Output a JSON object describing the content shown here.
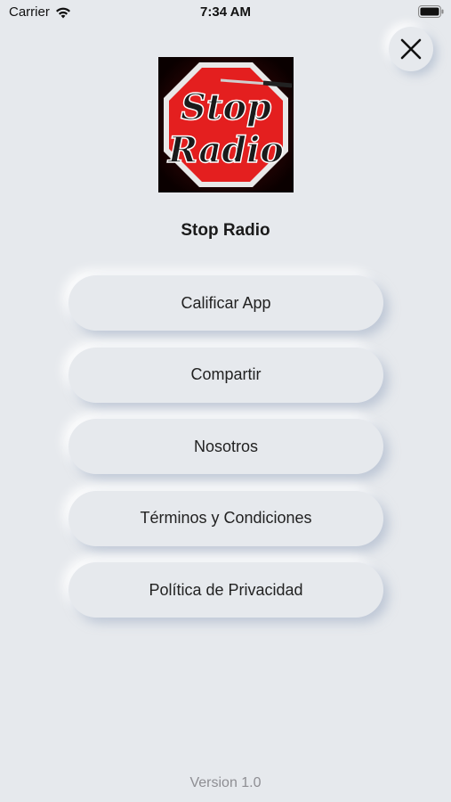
{
  "status_bar": {
    "carrier": "Carrier",
    "time": "7:34 AM"
  },
  "logo": {
    "line1": "Stop",
    "line2": "Radio",
    "octagon_color": "#e41f1f",
    "background_color": "#000000"
  },
  "app_name": "Stop Radio",
  "menu": {
    "items": [
      {
        "label": "Calificar App"
      },
      {
        "label": "Compartir"
      },
      {
        "label": "Nosotros"
      },
      {
        "label": "Términos y Condiciones"
      },
      {
        "label": "Política de Privacidad"
      }
    ]
  },
  "footer": {
    "version": "Version 1.0"
  },
  "icons": {
    "close": "close-icon",
    "wifi": "wifi-icon",
    "battery": "battery-icon"
  },
  "colors": {
    "background": "#e6e9ed",
    "text": "#222222",
    "version_text": "#8e8e93"
  }
}
